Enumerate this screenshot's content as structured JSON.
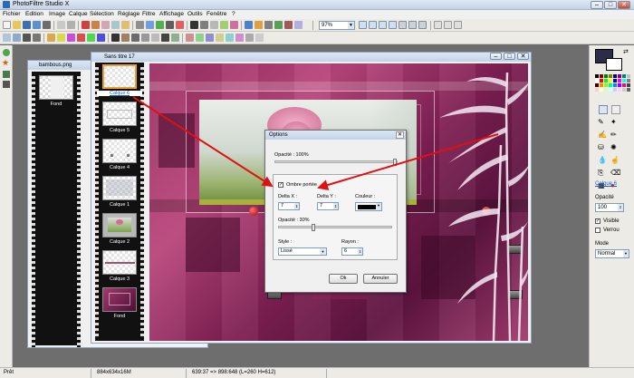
{
  "app": {
    "title": "PhotoFiltre Studio X",
    "window_buttons": [
      "–",
      "□",
      "✕"
    ]
  },
  "menu": [
    "Fichier",
    "Edition",
    "Image",
    "Calque",
    "Sélection",
    "Réglage",
    "Filtre",
    "Affichage",
    "Outils",
    "Fenêtre",
    "?"
  ],
  "toolbar": {
    "zoom": "97%"
  },
  "windows": {
    "bambous": {
      "title": "bambous.png",
      "layer": "Fond"
    },
    "sans_titre": {
      "title": "Sans titre 17"
    }
  },
  "layers": [
    "Calque 6",
    "Calque 5",
    "Calque 4",
    "Calque 1",
    "Calque 2",
    "Calque 3",
    "Fond"
  ],
  "dialog": {
    "title": "Options",
    "close": "✕",
    "opacity_label": "Opacité : 100%",
    "shadow_checkbox": "Ombre portée",
    "shadow_checked": "✓",
    "delta_x_label": "Delta X :",
    "delta_x": "7",
    "delta_y_label": "Delta Y :",
    "delta_y": "7",
    "color_label": "Couleur :",
    "shadow_opacity_label": "Opacité : 30%",
    "style_label": "Style :",
    "style_value": "Lissé",
    "radius_label": "Rayon :",
    "radius": "6",
    "ok": "Ok",
    "cancel": "Annuler",
    "shadow_color": "#000000"
  },
  "right_panel": {
    "layer_name": "Calque 6",
    "opacity_label": "Opacité",
    "opacity_value": "100",
    "visible_label": "Visible",
    "lock_label": "Verrou",
    "mode_label": "Mode",
    "mode_value": "Normal"
  },
  "status": {
    "ready": "Prêt",
    "size": "884x634x16M",
    "coords": "639:37 => 898:648 (L=260  H=612)"
  },
  "colors": {
    "accent": "#1a5fc8",
    "arrow": "#e01010",
    "canvas_main": "#9b2f63"
  }
}
